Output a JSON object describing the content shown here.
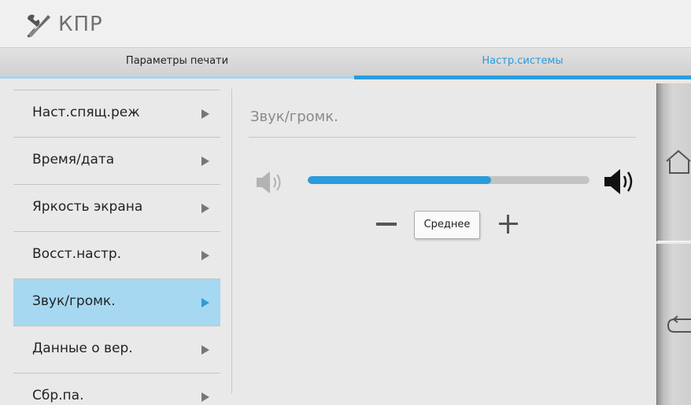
{
  "header": {
    "title": "КПР",
    "icon": "tools-icon"
  },
  "tabs": [
    {
      "label": "Параметры печати",
      "active": false
    },
    {
      "label": "Настр.системы",
      "active": true
    }
  ],
  "menu": {
    "items": [
      {
        "label": "Наст.спящ.реж",
        "active": false
      },
      {
        "label": "Время/дата",
        "active": false
      },
      {
        "label": "Яркость экрана",
        "active": false
      },
      {
        "label": "Восст.настр.",
        "active": false
      },
      {
        "label": "Звук/громк.",
        "active": true
      },
      {
        "label": "Данные о вер.",
        "active": false
      },
      {
        "label": "Сбр.па.",
        "active": false
      }
    ]
  },
  "panel": {
    "title": "Звук/громк.",
    "volume": {
      "level_label": "Среднее",
      "level_fraction": 0.65
    }
  },
  "sidebar": {
    "home_icon": "home-icon",
    "back_icon": "back-icon"
  },
  "colors": {
    "accent": "#2a9cdb",
    "active_menu_bg": "#a6d8f1",
    "background": "#e9e9e9"
  }
}
